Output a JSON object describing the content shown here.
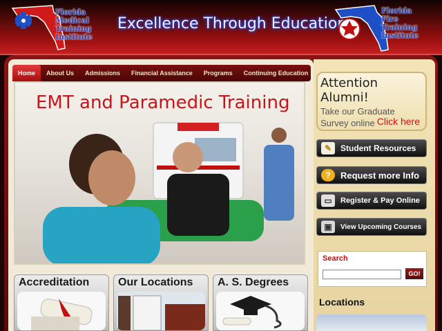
{
  "header": {
    "tagline": "Excellence Through Education",
    "left_logo_text": [
      "Florida",
      "Medical",
      "Training",
      "Institute"
    ],
    "right_logo_text": [
      "Florida",
      "Fire",
      "Training",
      "Institute"
    ]
  },
  "nav": {
    "items": [
      "Home",
      "About Us",
      "Admissions",
      "Financial Assistance",
      "Programs",
      "Continuing Education"
    ]
  },
  "hero": {
    "title": "EMT and Paramedic Training"
  },
  "boxes": [
    {
      "title": "Accreditation"
    },
    {
      "title": "Our Locations"
    },
    {
      "title": "A. S. Degrees"
    }
  ],
  "sidebar": {
    "alumni_heading": "Attention Alumni!",
    "alumni_text": "Take our Graduate Survey online",
    "alumni_link": "Click here",
    "buttons": [
      {
        "label": "Student Resources",
        "icon": "pencil-icon"
      },
      {
        "label": "Request more Info",
        "icon": "info-icon"
      },
      {
        "label": "Register & Pay Online",
        "icon": "credit-card-icon"
      },
      {
        "label": "View Upcoming Courses",
        "icon": "monitor-icon"
      }
    ],
    "search_label": "Search",
    "search_go": "GO!",
    "locations_heading": "Locations"
  },
  "colors": {
    "brand_red": "#c8141c",
    "nav_dark": "#4a0606",
    "sidebar_bg": "#f3e4b8"
  }
}
